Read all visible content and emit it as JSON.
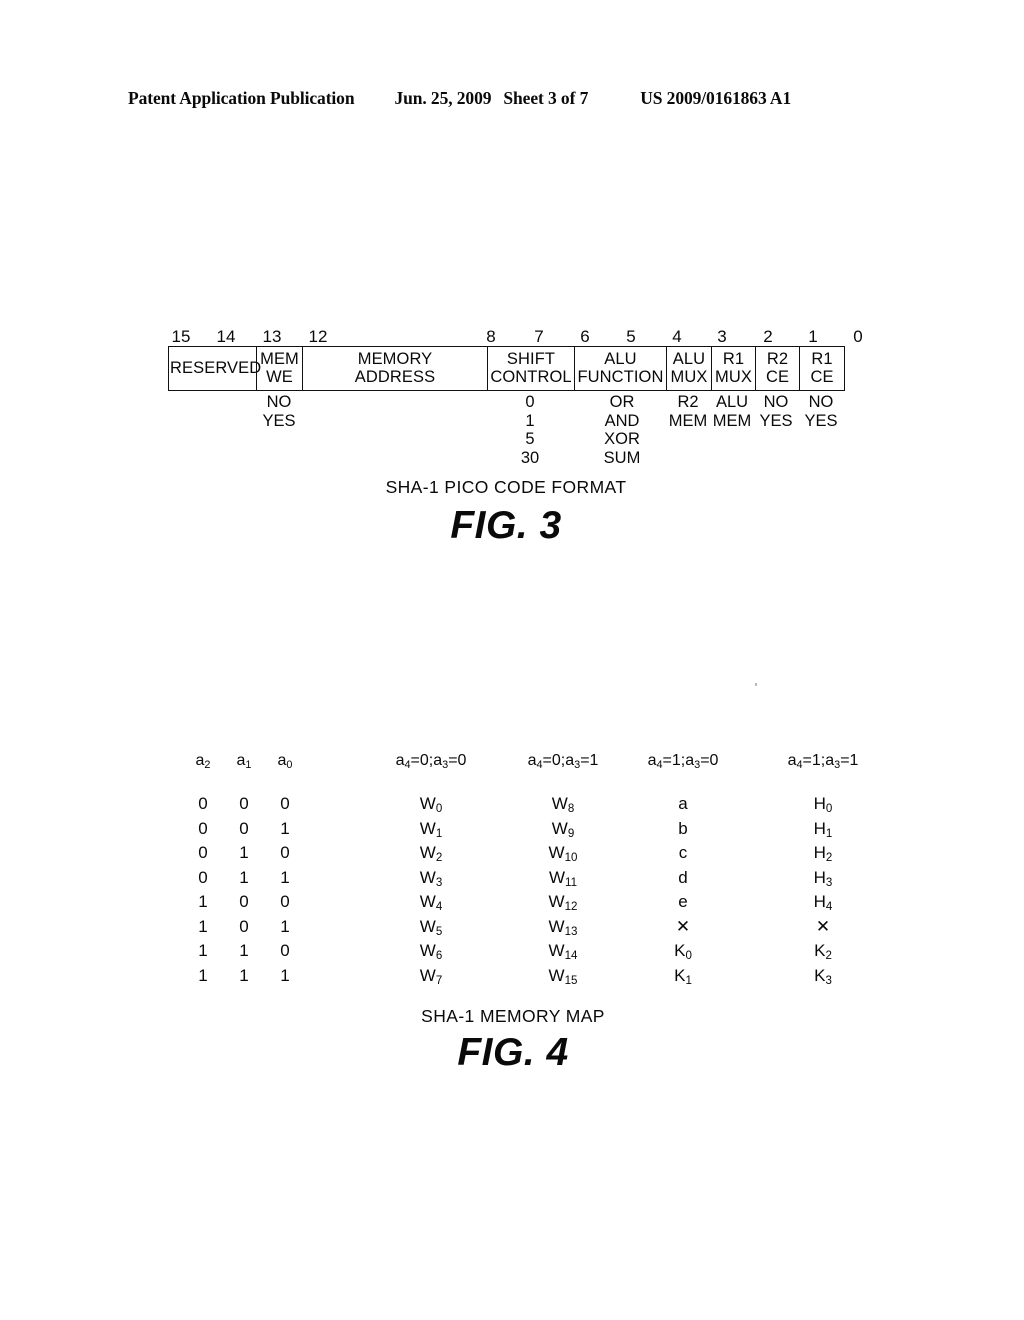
{
  "header": {
    "publication": "Patent Application Publication",
    "date": "Jun. 25, 2009",
    "sheet": "Sheet 3 of 7",
    "document_number": "US 2009/0161863 A1"
  },
  "fig3": {
    "caption": "SHA-1 PICO CODE FORMAT",
    "figure_number": "FIG. 3",
    "bit_labels": [
      "15",
      "14",
      "13",
      "12",
      "8",
      "7",
      "6",
      "5",
      "4",
      "3",
      "2",
      "1",
      "0"
    ],
    "fields": [
      {
        "name": "RESERVED",
        "bits": "15-14",
        "values": ""
      },
      {
        "name": "MEM\nWE",
        "bits": "13",
        "values": "NO\nYES"
      },
      {
        "name": "MEMORY\nADDRESS",
        "bits": "12-8",
        "values": ""
      },
      {
        "name": "SHIFT\nCONTROL",
        "bits": "7-6",
        "values": "0\n1\n5\n30"
      },
      {
        "name": "ALU\nFUNCTION",
        "bits": "5-4",
        "values": "OR\nAND\nXOR\nSUM"
      },
      {
        "name": "ALU\nMUX",
        "bits": "3",
        "values": "R2\nMEM"
      },
      {
        "name": "R1\nMUX",
        "bits": "2",
        "values": "ALU\nMEM"
      },
      {
        "name": "R2\nCE",
        "bits": "1",
        "values": "NO\nYES"
      },
      {
        "name": "R1\nCE",
        "bits": "0",
        "values": "NO\nYES"
      }
    ]
  },
  "fig4": {
    "caption": "SHA-1 MEMORY MAP",
    "figure_number": "FIG. 4",
    "headers": [
      "a<sub>2</sub>",
      "a<sub>1</sub>",
      "a<sub>0</sub>",
      "a<sub>4</sub>=0;a<sub>3</sub>=0",
      "a<sub>4</sub>=0;a<sub>3</sub>=1",
      "a<sub>4</sub>=1;a<sub>3</sub>=0",
      "a<sub>4</sub>=1;a<sub>3</sub>=1"
    ],
    "rows": [
      [
        "0",
        "0",
        "0",
        "W<sub>0</sub>",
        "W<sub>8</sub>",
        "a",
        "H<sub>0</sub>"
      ],
      [
        "0",
        "0",
        "1",
        "W<sub>1</sub>",
        "W<sub>9</sub>",
        "b",
        "H<sub>1</sub>"
      ],
      [
        "0",
        "1",
        "0",
        "W<sub>2</sub>",
        "W<sub>10</sub>",
        "c",
        "H<sub>2</sub>"
      ],
      [
        "0",
        "1",
        "1",
        "W<sub>3</sub>",
        "W<sub>11</sub>",
        "d",
        "H<sub>3</sub>"
      ],
      [
        "1",
        "0",
        "0",
        "W<sub>4</sub>",
        "W<sub>12</sub>",
        "e",
        "H<sub>4</sub>"
      ],
      [
        "1",
        "0",
        "1",
        "W<sub>5</sub>",
        "W<sub>13</sub>",
        "✕",
        "✕"
      ],
      [
        "1",
        "1",
        "0",
        "W<sub>6</sub>",
        "W<sub>14</sub>",
        "K<sub>0</sub>",
        "K<sub>2</sub>"
      ],
      [
        "1",
        "1",
        "1",
        "W<sub>7</sub>",
        "W<sub>15</sub>",
        "K<sub>1</sub>",
        "K<sub>3</sub>"
      ]
    ]
  }
}
